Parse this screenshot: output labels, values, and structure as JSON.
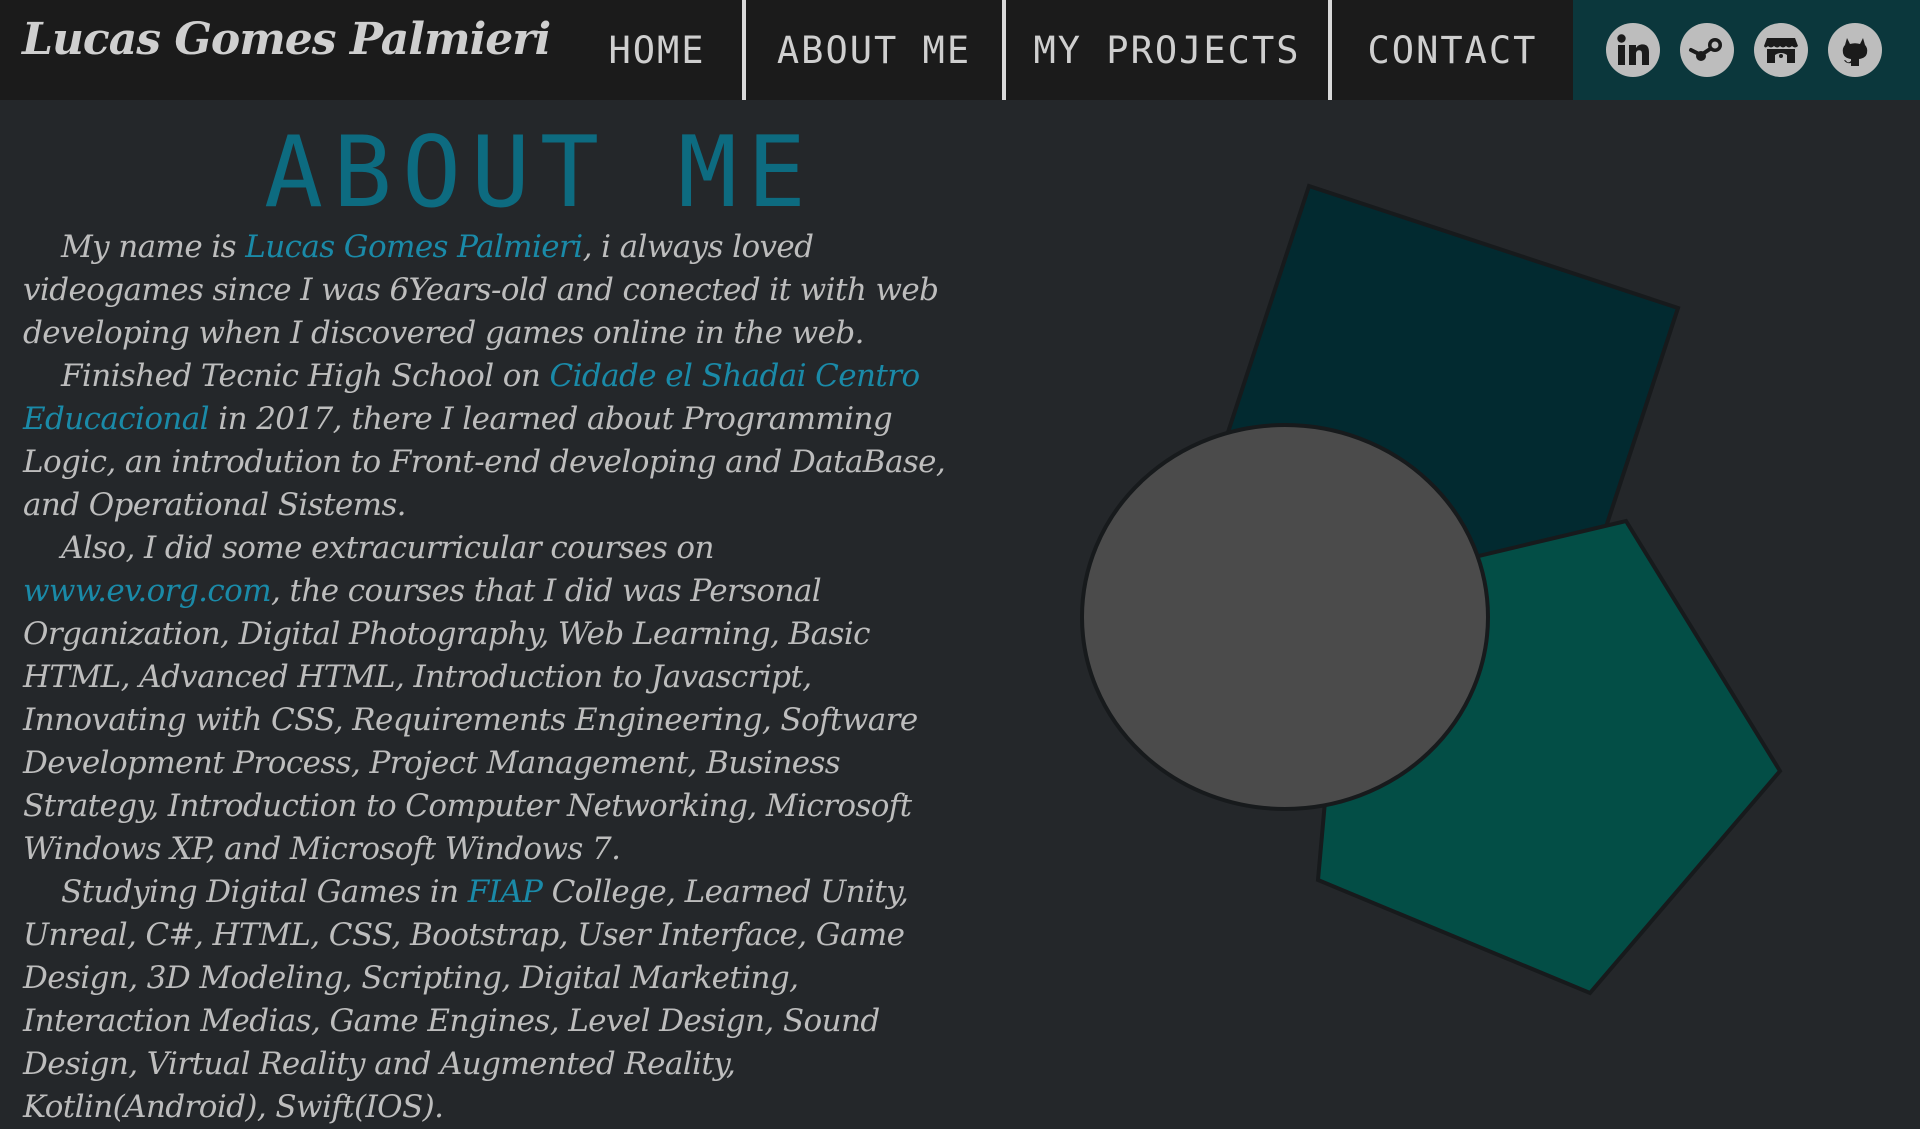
{
  "brand": "Lucas Gomes Palmieri",
  "nav": {
    "home": "HOME",
    "about": "ABOUT ME",
    "projects": "MY PROJECTS",
    "contact": "CONTACT"
  },
  "social": [
    {
      "icon": "linkedin-icon"
    },
    {
      "icon": "steam-icon"
    },
    {
      "icon": "itchio-icon"
    },
    {
      "icon": "github-icon"
    }
  ],
  "about": {
    "title": "ABOUT ME",
    "p1": {
      "a": "My name is ",
      "link": "Lucas Gomes Palmieri",
      "b": ", i always loved videogames since I was 6Years-old and conected it with web developing when I discovered games online in the web."
    },
    "p2": {
      "a": "Finished Tecnic High School on ",
      "link": "Cidade el Shadai Centro Educacional",
      "b": " in 2017, there I learned about Programming Logic, an introdution to Front-end developing and DataBase, and Operational Sistems."
    },
    "p3": {
      "a": "Also, I did some extracurricular courses on ",
      "link": "www.ev.org.com",
      "b": ", the courses that I did was Personal Organization, Digital Photography, Web Learning, Basic HTML, Advanced HTML, Introduction to  Javascript, Innovating with CSS, Requirements Engineering, Software Development Process, Project Management, Business Strategy, Introduction to Computer Networking, Microsoft Windows XP, and Microsoft Windows 7."
    },
    "p4": {
      "a": "Studying Digital Games in ",
      "link": "FIAP",
      "b": " College, Learned Unity, Unreal, C#, HTML, CSS, Bootstrap, User Interface, Game Design, 3D Modeling, Scripting, Digital Marketing, Interaction Medias, Game Engines, Level Design, Sound Design, Virtual Reality and Augmented Reality, Kotlin(Android), Swift(IOS)."
    }
  },
  "colors": {
    "background": "#24272a",
    "topbar": "#1b1b1b",
    "social_bar": "#0b373c",
    "accent": "#0d6b80",
    "link": "#1a8aa8",
    "text": "#bdbdbd",
    "square": "#022a30",
    "pentagon": "#034e46",
    "circle": "#4b4b4b"
  }
}
